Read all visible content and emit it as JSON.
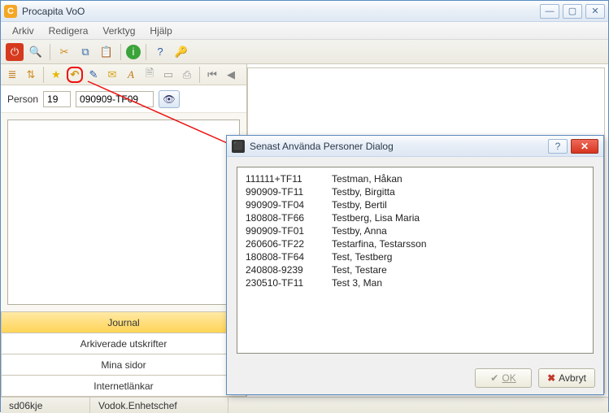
{
  "window": {
    "title": "Procapita VoO"
  },
  "menu": {
    "arkiv": "Arkiv",
    "redigera": "Redigera",
    "verktyg": "Verktyg",
    "hjalp": "Hjälp"
  },
  "person": {
    "label": "Person",
    "code": "19",
    "ssn": "090909-TF09"
  },
  "tabs": {
    "journal": "Journal",
    "arkiverade": "Arkiverade utskrifter",
    "minasidor": "Mina sidor",
    "internet": "Internetlänkar"
  },
  "status": {
    "user": "sd06kje",
    "role": "Vodok.Enhetschef"
  },
  "dialog": {
    "title": "Senast Använda Personer Dialog",
    "ok": "OK",
    "cancel": "Avbryt",
    "rows": [
      {
        "id": "111111+TF11",
        "name": "Testman, Håkan"
      },
      {
        "id": "990909-TF11",
        "name": "Testby, Birgitta"
      },
      {
        "id": "990909-TF04",
        "name": "Testby, Bertil"
      },
      {
        "id": "180808-TF66",
        "name": "Testberg, Lisa Maria"
      },
      {
        "id": "990909-TF01",
        "name": "Testby, Anna"
      },
      {
        "id": "260606-TF22",
        "name": "Testarfina, Testarsson"
      },
      {
        "id": "180808-TF64",
        "name": "Test, Testberg"
      },
      {
        "id": "240808-9239",
        "name": "Test, Testare"
      },
      {
        "id": "230510-TF11",
        "name": "Test 3, Man"
      }
    ]
  }
}
